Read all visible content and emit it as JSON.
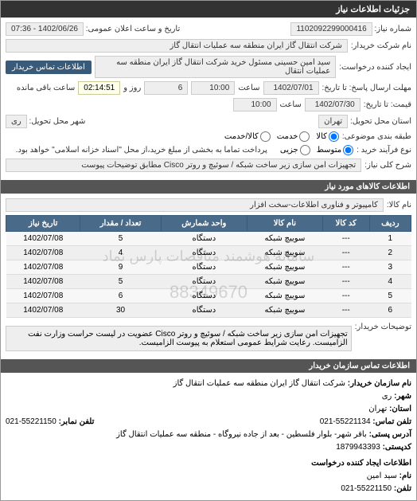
{
  "header": {
    "title": "جزئیات اطلاعات نیاز"
  },
  "info": {
    "need_no_label": "شماره نیاز:",
    "need_no": "1102092299000416",
    "announce_label": "تاریخ و ساعت اعلان عمومی:",
    "announce_value": "1402/06/26 - 07:36",
    "buyer_name_label": "نام شرکت خریدار:",
    "buyer_name": "شرکت انتقال گاز ایران منطقه سه عملیات انتقال گاز",
    "requester_label": "ایجاد کننده درخواست:",
    "requester": "سید امین حسینی مسئول خرید شرکت انتقال گاز ایران منطقه سه عملیات انتقال",
    "contact_btn": "اطلاعات تماس خریدار",
    "deadline_label": "مهلت ارسال پاسخ: تا تاریخ:",
    "deadline_date": "1402/07/01",
    "time_label": "ساعت",
    "deadline_time": "10:00",
    "days_remain": "6",
    "days_remain_suffix": "روز و",
    "timer": "02:14:51",
    "timer_suffix": "ساعت باقی مانده",
    "price_valid_label": "قیمت: تا تاریخ:",
    "price_valid_date": "1402/07/30",
    "price_valid_time": "10:00",
    "province_label": "استان محل تحویل:",
    "province": "تهران",
    "city_label": "شهر محل تحویل:",
    "city": "ری",
    "category_label": "طبقه بندی موضوعی:",
    "cat_goods": "کالا",
    "cat_service": "خدمت",
    "cat_both": "کالا/خدمت",
    "purchase_type_label": "نوع فرآیند خرید :",
    "pt_medium": "متوسط",
    "pt_small": "جزیی",
    "payment_note": "پرداخت تماما به بخشی از مبلغ خرید،از محل \"اسناد خزانه اسلامی\" خواهد بود.",
    "desc_label": "شرح کلی نیاز:",
    "desc": "تجهیزات امن سازی زیر ساخت شبکه / سوئیچ و روتر Cisco مطابق توضیحات پیوست"
  },
  "goods": {
    "header": "اطلاعات کالاهای مورد نیاز",
    "name_label": "نام کالا:",
    "name": "کامپیوتر و فناوری اطلاعات-سخت افزار",
    "columns": [
      "ردیف",
      "کد کالا",
      "نام کالا",
      "واحد شمارش",
      "تعداد / مقدار",
      "تاریخ نیاز"
    ],
    "rows": [
      {
        "idx": "1",
        "code": "---",
        "name": "سوییچ شبکه",
        "unit": "دستگاه",
        "qty": "5",
        "date": "1402/07/08"
      },
      {
        "idx": "2",
        "code": "---",
        "name": "سوییچ شبکه",
        "unit": "دستگاه",
        "qty": "4",
        "date": "1402/07/08"
      },
      {
        "idx": "3",
        "code": "---",
        "name": "سوییچ شبکه",
        "unit": "دستگاه",
        "qty": "9",
        "date": "1402/07/08"
      },
      {
        "idx": "4",
        "code": "---",
        "name": "سوییچ شبکه",
        "unit": "دستگاه",
        "qty": "5",
        "date": "1402/07/08"
      },
      {
        "idx": "5",
        "code": "---",
        "name": "سوییچ شبکه",
        "unit": "دستگاه",
        "qty": "6",
        "date": "1402/07/08"
      },
      {
        "idx": "6",
        "code": "---",
        "name": "سوییچ شبکه",
        "unit": "دستگاه",
        "qty": "30",
        "date": "1402/07/08"
      }
    ],
    "watermark1": "سامانه هوشمند مناقصات پارس نماد",
    "watermark2": "88349670",
    "buyer_notes_label": "توضیحات خریدار:",
    "buyer_notes": "تجهیزات امن سازی زیر ساخت شبکه / سوئیچ و روتر Cisco عضویت در لیست حراست وزارت نفت الزامیست. رعایت شرایط عمومی استعلام به پیوست الزامیست."
  },
  "contact": {
    "header": "اطلاعات تماس سازمان خریدار",
    "org_label": "نام سازمان خریدار:",
    "org": "شرکت انتقال گاز ایران منطقه سه عملیات انتقال گاز",
    "city_label": "شهر:",
    "city": "ری",
    "province_label": "استان:",
    "province": "تهران",
    "phone_label": "تلفن تماس:",
    "phone": "55221134-021",
    "fax_label": "تلفن نمابر:",
    "fax": "55221150-021",
    "address_label": "آدرس پستی:",
    "address": "باقر شهر- بلوار فلسطین - بعد از جاده نیروگاه - منطقه سه عملیات انتقال گاز",
    "postcode_label": "کدپستی:",
    "postcode": "1879943393",
    "creator_header": "اطلاعات ایجاد کننده درخواست",
    "creator_name_label": "نام:",
    "creator_name": "سید امین",
    "creator_phone_label": "تلفن:",
    "creator_phone": "55221150-021"
  }
}
